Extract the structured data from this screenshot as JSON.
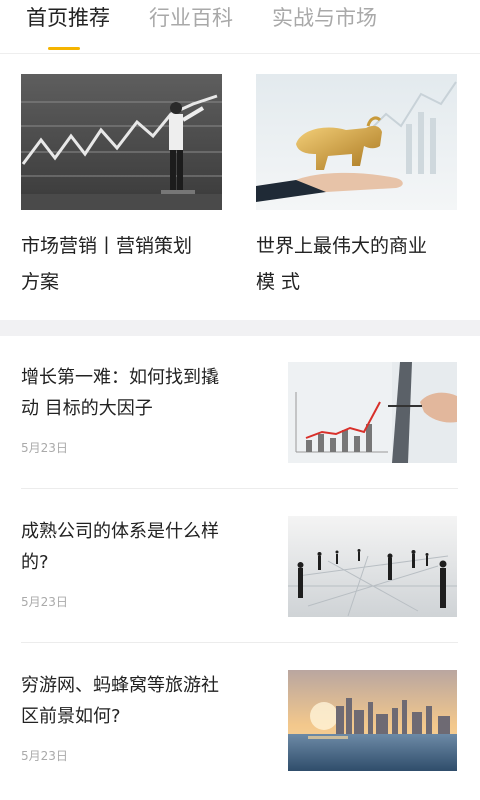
{
  "tabs": [
    {
      "label": "首页推荐",
      "active": true
    },
    {
      "label": "行业百科",
      "active": false
    },
    {
      "label": "实战与市场",
      "active": false
    }
  ],
  "colors": {
    "accent": "#f5b400",
    "muted": "#a9a9a9",
    "band": "#f1f1f3"
  },
  "featured": [
    {
      "title_line1": "市场营销丨营销策划",
      "title_line2": "方案",
      "image": "businessman-drawing-chart-image"
    },
    {
      "title_line1": "世界上最伟大的商业",
      "title_line2": "模 式",
      "image": "golden-bull-in-hand-image"
    }
  ],
  "articles": [
    {
      "title_line1": "增长第一难：如何找到撬",
      "title_line2": "动 目标的大因子",
      "date": "5月23日",
      "image": "hand-drawing-rising-graph-image"
    },
    {
      "title_line1": "成熟公司的体系是什么样",
      "title_line2": "的?",
      "date": "5月23日",
      "image": "business-people-network-image"
    },
    {
      "title_line1": "穷游网、蚂蜂窝等旅游社",
      "title_line2": "区前景如何?",
      "date": "5月23日",
      "image": "city-skyline-sunset-image"
    }
  ]
}
